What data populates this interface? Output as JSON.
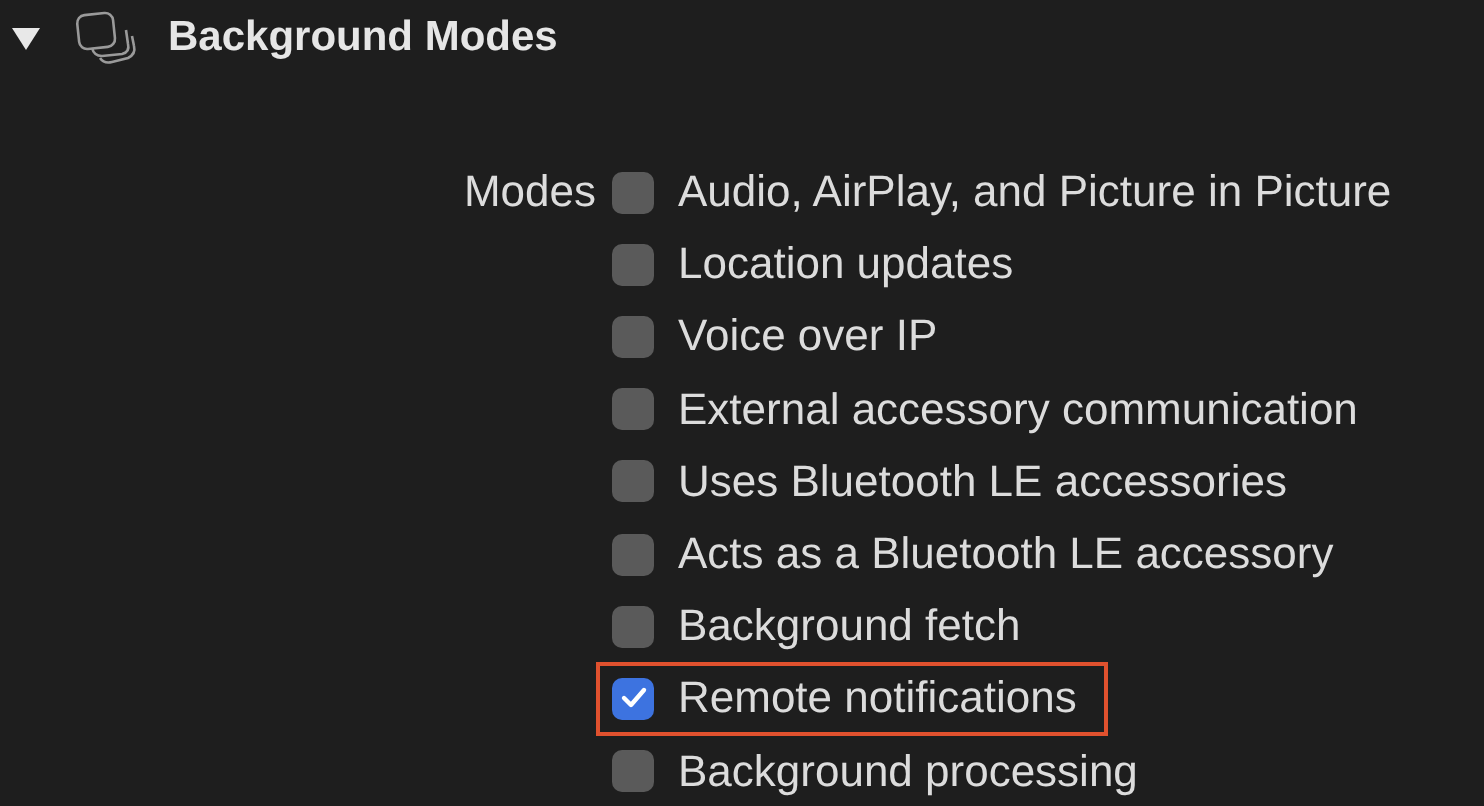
{
  "section": {
    "title": "Background Modes",
    "expanded": true
  },
  "modes_label": "Modes",
  "modes": [
    {
      "label": "Audio, AirPlay, and Picture in Picture",
      "checked": false,
      "highlighted": false
    },
    {
      "label": "Location updates",
      "checked": false,
      "highlighted": false
    },
    {
      "label": "Voice over IP",
      "checked": false,
      "highlighted": false
    },
    {
      "label": "External accessory communication",
      "checked": false,
      "highlighted": false
    },
    {
      "label": "Uses Bluetooth LE accessories",
      "checked": false,
      "highlighted": false
    },
    {
      "label": "Acts as a Bluetooth LE accessory",
      "checked": false,
      "highlighted": false
    },
    {
      "label": "Background fetch",
      "checked": false,
      "highlighted": false
    },
    {
      "label": "Remote notifications",
      "checked": true,
      "highlighted": true
    },
    {
      "label": "Background processing",
      "checked": false,
      "highlighted": false
    }
  ]
}
